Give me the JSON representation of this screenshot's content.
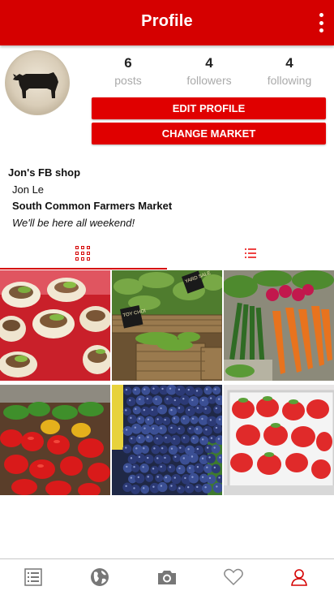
{
  "header": {
    "title": "Profile",
    "overflow_icon": "more-vert-icon"
  },
  "profile": {
    "avatar_icon": "cow-icon",
    "stats": [
      {
        "value": "6",
        "label": "posts"
      },
      {
        "value": "4",
        "label": "followers"
      },
      {
        "value": "4",
        "label": "following"
      }
    ],
    "edit_button": "EDIT PROFILE",
    "market_button": "CHANGE MARKET"
  },
  "bio": {
    "shop_name": "Jon's FB shop",
    "owner": "Jon Le",
    "market": "South Common Farmers Market",
    "tagline": "We'll be here all weekend!"
  },
  "tabs": [
    {
      "icon": "grid-view-icon",
      "active": true
    },
    {
      "icon": "list-view-icon",
      "active": false
    }
  ],
  "posts": [
    {
      "subject": "tacos"
    },
    {
      "subject": "greens"
    },
    {
      "subject": "carrots-radishes"
    },
    {
      "subject": "peppers"
    },
    {
      "subject": "blueberries"
    },
    {
      "subject": "strawberries"
    }
  ],
  "photo_signs": {
    "sign_a": "YARD SALE",
    "sign_b": "TOY CHOI"
  },
  "bottom_nav": [
    {
      "icon": "feed-list-icon"
    },
    {
      "icon": "globe-icon"
    },
    {
      "icon": "camera-icon"
    },
    {
      "icon": "heart-icon"
    },
    {
      "icon": "profile-icon",
      "active": true
    }
  ],
  "colors": {
    "primary": "#d50000",
    "button": "#e00000",
    "muted_text": "#aaaaaa"
  }
}
